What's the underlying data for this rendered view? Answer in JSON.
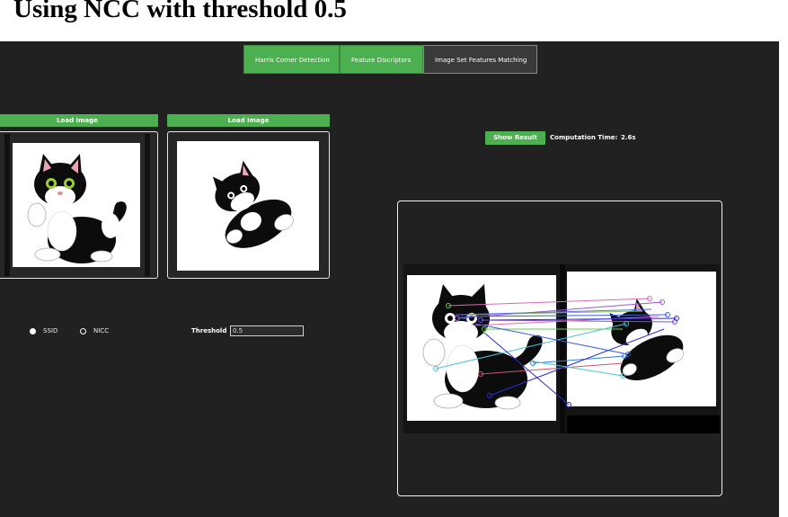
{
  "heading": "Using NCC with threshold 0.5",
  "tabs": [
    {
      "label": "Harris Corner Detection",
      "active": false
    },
    {
      "label": "Feature Discriptors",
      "active": false
    },
    {
      "label": "Image Set Features Matching",
      "active": true
    }
  ],
  "panel1": {
    "load_label": "Load Image"
  },
  "panel2": {
    "load_label": "Load Image"
  },
  "method": {
    "options": [
      {
        "label": "SSID",
        "selected": true
      },
      {
        "label": "NICC",
        "selected": false
      }
    ]
  },
  "threshold": {
    "label": "Threshold",
    "value": "0.5"
  },
  "result": {
    "button_label": "Show Result",
    "time_label": "Computation Time:",
    "time_value": "2.6s"
  },
  "colors": {
    "accent": "#4caf50",
    "background": "#212121",
    "active_tab": "#3a3a3a"
  }
}
